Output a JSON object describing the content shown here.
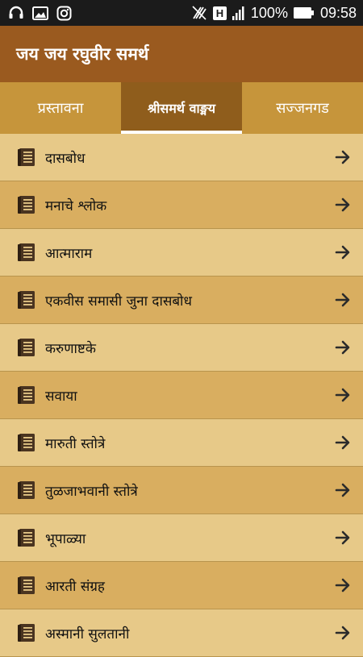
{
  "status_bar": {
    "battery": "100%",
    "time": "09:58",
    "network_badge": "H",
    "icons": [
      "headset-icon",
      "image-icon",
      "instagram-icon",
      "no-sim-icon",
      "network-h-icon",
      "signal-icon",
      "battery-icon"
    ]
  },
  "app_bar": {
    "title": "जय जय रघुवीर समर्थ"
  },
  "tabs": [
    {
      "label": "प्रस्तावना",
      "active": false
    },
    {
      "label": "श्रीसमर्थ वाङ्मय",
      "active": true
    },
    {
      "label": "सज्जनगड",
      "active": false
    }
  ],
  "items": [
    {
      "label": "दासबोध",
      "icon": "book-icon",
      "action_icon": "arrow-right-icon"
    },
    {
      "label": "मनाचे श्लोक",
      "icon": "book-icon",
      "action_icon": "arrow-right-icon"
    },
    {
      "label": "आत्माराम",
      "icon": "book-icon",
      "action_icon": "arrow-right-icon"
    },
    {
      "label": "एकवीस समासी जुना दासबोध",
      "icon": "book-icon",
      "action_icon": "arrow-right-icon"
    },
    {
      "label": "करुणाष्टके",
      "icon": "book-icon",
      "action_icon": "arrow-right-icon"
    },
    {
      "label": "सवाया",
      "icon": "book-icon",
      "action_icon": "arrow-right-icon"
    },
    {
      "label": "मारुती स्तोत्रे",
      "icon": "book-icon",
      "action_icon": "arrow-right-icon"
    },
    {
      "label": "तुळजाभवानी स्तोत्रे",
      "icon": "book-icon",
      "action_icon": "arrow-right-icon"
    },
    {
      "label": "भूपाळ्या",
      "icon": "book-icon",
      "action_icon": "arrow-right-icon"
    },
    {
      "label": "आरती संग्रह",
      "icon": "book-icon",
      "action_icon": "arrow-right-icon"
    },
    {
      "label": "अस्मानी सुलतानी",
      "icon": "book-icon",
      "action_icon": "arrow-right-icon"
    }
  ],
  "colors": {
    "app_bar": "#9a5a1f",
    "tab_bar": "#c6953b",
    "tab_active": "#8f5d1c",
    "row_light": "#e7c988",
    "row_dark": "#d9ae60",
    "icon": "#4a3420"
  }
}
